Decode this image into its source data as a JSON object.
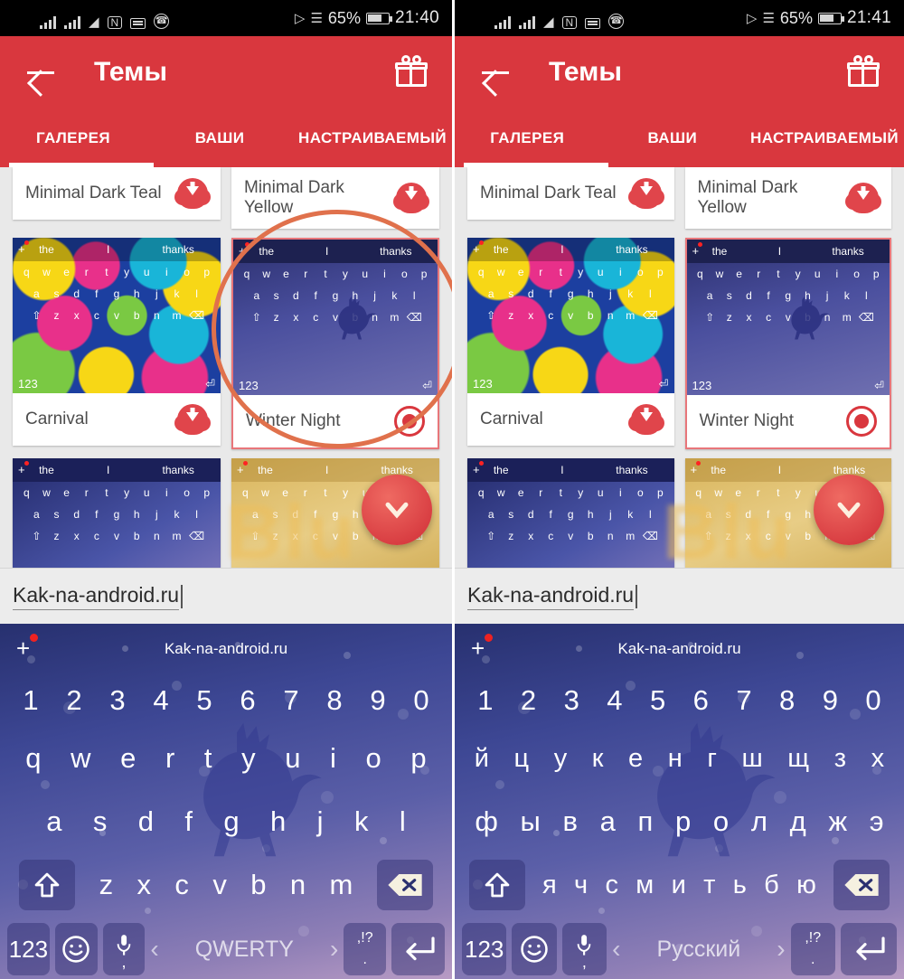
{
  "panels": [
    {
      "statusbar": {
        "icons": [
          "signal-bars",
          "signal-bars-2",
          "wifi-icon",
          "nfc-icon",
          "keyboard-icon",
          "viber-icon"
        ],
        "bluetooth": "bluetooth-icon",
        "vibrate": "vibrate-icon",
        "battery_percent": "65%",
        "time": "21:40"
      },
      "appbar": {
        "back": "back-arrow",
        "title": "Темы",
        "gift": "gift-icon"
      },
      "tabs": [
        {
          "label": "ГАЛЕРЕЯ",
          "active": true
        },
        {
          "label": "ВАШИ",
          "active": false
        },
        {
          "label": "НАСТРАИВАЕМЫЙ",
          "active": false
        }
      ],
      "themes": [
        {
          "name": "Minimal Dark Teal",
          "action": "download"
        },
        {
          "name": "Minimal Dark Yellow",
          "action": "download"
        },
        {
          "name": "Carnival",
          "action": "download"
        },
        {
          "name": "Winter Night",
          "action": "selected"
        }
      ],
      "url_field": {
        "value": "Kak-na-android.ru"
      },
      "keyboard": {
        "suggestion": "Kak-na-android.ru",
        "plus": "+",
        "numbers": [
          "1",
          "2",
          "3",
          "4",
          "5",
          "6",
          "7",
          "8",
          "9",
          "0"
        ],
        "row1": [
          "q",
          "w",
          "e",
          "r",
          "t",
          "y",
          "u",
          "i",
          "o",
          "p"
        ],
        "row2": [
          "a",
          "s",
          "d",
          "f",
          "g",
          "h",
          "j",
          "k",
          "l"
        ],
        "row3": [
          "z",
          "x",
          "c",
          "v",
          "b",
          "n",
          "m"
        ],
        "num_key": "123",
        "space_label": "QWERTY",
        "punct_top": ",!?",
        "punct_bottom": ".",
        "comma": ","
      },
      "thumb_suggestions": [
        "the",
        "I",
        "thanks"
      ]
    },
    {
      "statusbar": {
        "icons": [
          "signal-bars",
          "signal-bars-2",
          "wifi-icon",
          "nfc-icon",
          "keyboard-icon",
          "viber-icon"
        ],
        "bluetooth": "bluetooth-icon",
        "vibrate": "vibrate-icon",
        "battery_percent": "65%",
        "time": "21:41"
      },
      "appbar": {
        "back": "back-arrow",
        "title": "Темы",
        "gift": "gift-icon"
      },
      "tabs": [
        {
          "label": "ГАЛЕРЕЯ",
          "active": true
        },
        {
          "label": "ВАШИ",
          "active": false
        },
        {
          "label": "НАСТРАИВАЕМЫЙ",
          "active": false
        }
      ],
      "themes": [
        {
          "name": "Minimal Dark Teal",
          "action": "download"
        },
        {
          "name": "Minimal Dark Yellow",
          "action": "download"
        },
        {
          "name": "Carnival",
          "action": "download"
        },
        {
          "name": "Winter Night",
          "action": "selected"
        }
      ],
      "url_field": {
        "value": "Kak-na-android.ru"
      },
      "keyboard": {
        "suggestion": "Kak-na-android.ru",
        "plus": "+",
        "numbers": [
          "1",
          "2",
          "3",
          "4",
          "5",
          "6",
          "7",
          "8",
          "9",
          "0"
        ],
        "row1": [
          "й",
          "ц",
          "у",
          "к",
          "е",
          "н",
          "г",
          "ш",
          "щ",
          "з",
          "х"
        ],
        "row2": [
          "ф",
          "ы",
          "в",
          "а",
          "п",
          "р",
          "о",
          "л",
          "д",
          "ж",
          "э"
        ],
        "row3": [
          "я",
          "ч",
          "с",
          "м",
          "и",
          "т",
          "ь",
          "б",
          "ю"
        ],
        "num_key": "123",
        "space_label": "Русский",
        "punct_top": ",!?",
        "punct_bottom": ".",
        "comma": ","
      },
      "thumb_suggestions": [
        "the",
        "I",
        "thanks"
      ]
    }
  ],
  "watermark": {
    "text": "Blu"
  },
  "colors": {
    "accent_red": "#d9373e",
    "download_red": "#e0454b",
    "annotation_orange": "#e0714c",
    "winter_dark": "#1d2150"
  }
}
